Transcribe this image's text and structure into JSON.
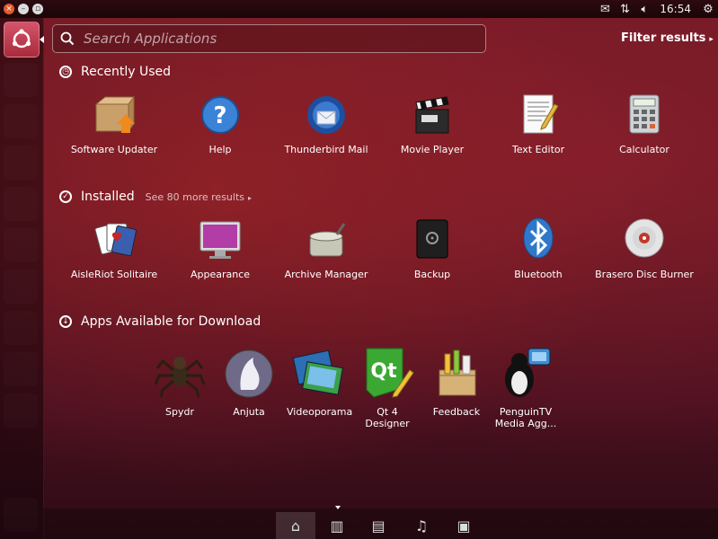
{
  "panel": {
    "clock": "16:54"
  },
  "search": {
    "placeholder": "Search Applications",
    "value": ""
  },
  "filter": {
    "label": "Filter results"
  },
  "recently_used": {
    "title": "Recently Used",
    "apps": [
      {
        "label": "Software Updater",
        "icon": "software-updater-icon"
      },
      {
        "label": "Help",
        "icon": "help-icon"
      },
      {
        "label": "Thunderbird Mail",
        "icon": "thunderbird-icon"
      },
      {
        "label": "Movie Player",
        "icon": "movie-player-icon"
      },
      {
        "label": "Text Editor",
        "icon": "text-editor-icon"
      },
      {
        "label": "Calculator",
        "icon": "calculator-icon"
      }
    ]
  },
  "installed": {
    "title": "Installed",
    "see_more": "See 80 more results",
    "apps": [
      {
        "label": "AisleRiot Solitaire",
        "icon": "solitaire-icon"
      },
      {
        "label": "Appearance",
        "icon": "appearance-icon"
      },
      {
        "label": "Archive Manager",
        "icon": "archive-manager-icon"
      },
      {
        "label": "Backup",
        "icon": "backup-icon"
      },
      {
        "label": "Bluetooth",
        "icon": "bluetooth-icon"
      },
      {
        "label": "Brasero Disc Burner",
        "icon": "brasero-icon"
      }
    ]
  },
  "download": {
    "title": "Apps Available for Download",
    "apps": [
      {
        "label": "Spydr",
        "icon": "spider-icon"
      },
      {
        "label": "Anjuta",
        "icon": "anjuta-icon"
      },
      {
        "label": "Videoporama",
        "icon": "videoporama-icon"
      },
      {
        "label": "Qt 4 Designer",
        "icon": "qt-designer-icon"
      },
      {
        "label": "Feedback",
        "icon": "feedback-icon"
      },
      {
        "label": "PenguinTV Media Agg...",
        "icon": "penguintv-icon"
      }
    ]
  },
  "lenses": [
    "home-lens-icon",
    "applications-lens-icon",
    "files-lens-icon",
    "music-lens-icon",
    "video-lens-icon"
  ],
  "colors": {
    "accent": "#dd4814",
    "background": "#661625"
  }
}
